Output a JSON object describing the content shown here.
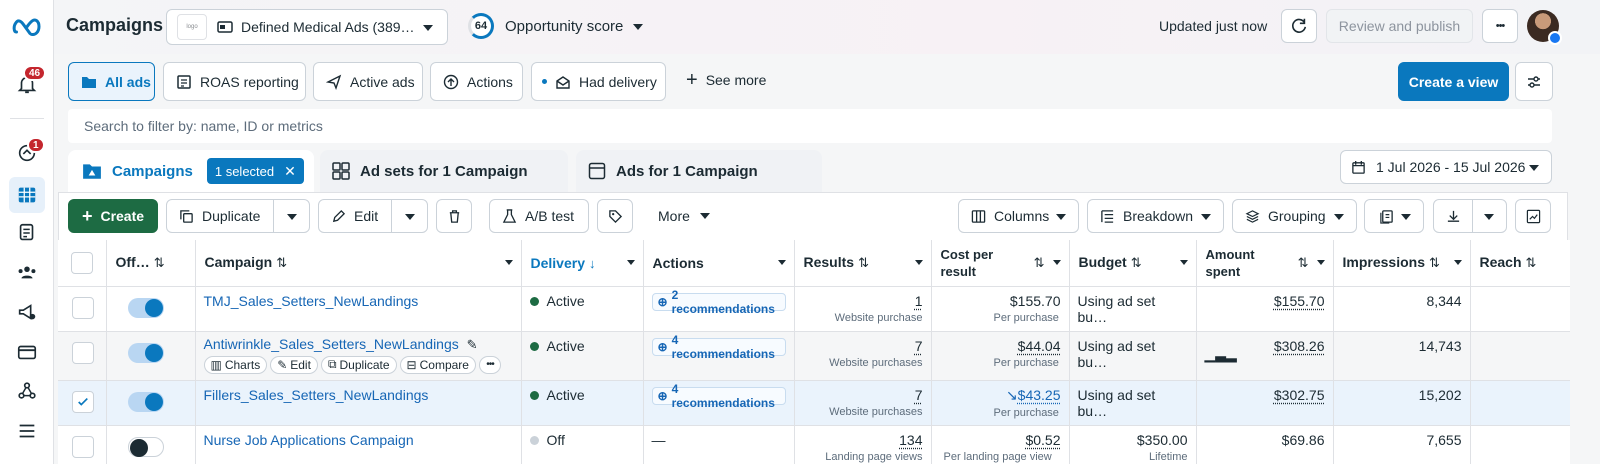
{
  "header": {
    "title": "Campaigns",
    "account": "Defined Medical Ads (389…",
    "score_value": "64",
    "score_label": "Opportunity score",
    "updated": "Updated just now",
    "review": "Review and publish",
    "more": "•••"
  },
  "sidebar": {
    "notif_badge": "46",
    "alerts_badge": "1"
  },
  "views": {
    "all_ads": "All ads",
    "roas": "ROAS reporting",
    "active_ads": "Active ads",
    "actions": "Actions",
    "had_delivery": "Had delivery",
    "see_more": "See more",
    "create_view": "Create a view"
  },
  "search": {
    "placeholder": "Search to filter by: name, ID or metrics"
  },
  "tabs": {
    "campaigns": "Campaigns",
    "selected": "1 selected",
    "ad_sets": "Ad sets for 1 Campaign",
    "ads": "Ads for 1 Campaign",
    "date_range": "1 Jul 2026 - 15 Jul 2026"
  },
  "toolbar": {
    "create": "Create",
    "duplicate": "Duplicate",
    "edit": "Edit",
    "ab_test": "A/B test",
    "more": "More",
    "columns": "Columns",
    "breakdown": "Breakdown",
    "grouping": "Grouping"
  },
  "table": {
    "headers": {
      "offon": "Off…",
      "campaign": "Campaign",
      "delivery": "Delivery",
      "actions": "Actions",
      "results": "Results",
      "cpr1": "Cost per",
      "cpr2": "result",
      "budget": "Budget",
      "amount1": "Amount",
      "amount2": "spent",
      "impressions": "Impressions",
      "reach": "Reach"
    },
    "row_actions": {
      "charts": "Charts",
      "edit": "Edit",
      "duplicate": "Duplicate",
      "compare": "Compare"
    },
    "rows": [
      {
        "name": "TMJ_Sales_Setters_NewLandings",
        "delivery": "Active",
        "actions": "2 recommendations",
        "results": "1",
        "results_sub": "Website purchase",
        "cpr": "$155.70",
        "cpr_sub": "Per purchase",
        "budget": "Using ad set bu…",
        "budget_sub": "",
        "amount": "$155.70",
        "impressions": "8,344",
        "reach": ""
      },
      {
        "name": "Antiwrinkle_Sales_Setters_NewLandings",
        "delivery": "Active",
        "actions": "4 recommendations",
        "results": "7",
        "results_sub": "Website purchases",
        "cpr": "$44.04",
        "cpr_sub": "Per purchase",
        "budget": "Using ad set bu…",
        "budget_sub": "",
        "amount": "$308.26",
        "impressions": "14,743",
        "reach": ""
      },
      {
        "name": "Fillers_Sales_Setters_NewLandings",
        "delivery": "Active",
        "actions": "4 recommendations",
        "results": "7",
        "results_sub": "Website purchases",
        "cpr": "$43.25",
        "cpr_sub": "Per purchase",
        "budget": "Using ad set bu…",
        "budget_sub": "",
        "amount": "$302.75",
        "impressions": "15,202",
        "reach": ""
      },
      {
        "name": "Nurse Job Applications Campaign",
        "delivery": "Off",
        "actions": "—",
        "results": "134",
        "results_sub": "Landing page views",
        "cpr": "$0.52",
        "cpr_sub": "Per landing page view",
        "budget": "$350.00",
        "budget_sub": "Lifetime",
        "amount": "$69.86",
        "impressions": "7,655",
        "reach": ""
      }
    ]
  },
  "colors": {
    "accent": "#0a78be",
    "link": "#1666b5",
    "active": "#1d6b43",
    "badge": "#c4262e"
  }
}
